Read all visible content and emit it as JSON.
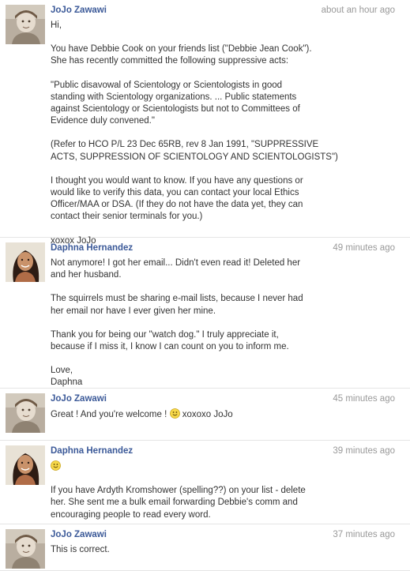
{
  "messages": [
    {
      "author": "JoJo Zawawi",
      "time": "about an hour ago",
      "paragraphs": [
        "Hi,",
        "You have Debbie Cook on your friends list (\"Debbie Jean Cook\").\nShe has recently committed the following suppressive acts:",
        "\"Public disavowal of Scientology or Scientologists in good\nstanding with Scientology organizations. ... Public statements\nagainst Scientology or Scientologists but not to Committees of\nEvidence duly convened.\"",
        "(Refer to HCO P/L 23 Dec 65RB, rev 8 Jan 1991, \"SUPPRESSIVE\nACTS, SUPPRESSION OF SCIENTOLOGY AND SCIENTOLOGISTS\")",
        "I thought you would want to know. If you have any questions or\nwould like to verify this data, you can contact your local Ethics\nOfficer/MAA or DSA. (If they do not have the data yet, they can\ncontact their senior terminals for you.)",
        "xoxox JoJo"
      ]
    },
    {
      "author": "Daphna Hernandez",
      "time": "49 minutes ago",
      "paragraphs": [
        "Not anymore! I got her email... Didn't even read it! Deleted her\nand her husband.",
        "The squirrels must be sharing e-mail lists, because I never had\nher email nor have I ever given her mine.",
        "Thank you for being our \"watch dog.\" I truly appreciate it,\nbecause if I miss it, I know I can count on you to inform me.",
        "Love,\nDaphna"
      ]
    },
    {
      "author": "JoJo Zawawi",
      "time": "45 minutes ago",
      "text_before_smiley": "Great ! And you're welcome ! ",
      "text_after_smiley": " xoxoxo JoJo"
    },
    {
      "author": "Daphna Hernandez",
      "time": "39 minutes ago",
      "paragraphs": [
        "If you have Ardyth Kromshower (spelling??) on your list - delete\nher. She sent me a bulk email forwarding Debbie's comm and\nencouraging people to read every word."
      ]
    },
    {
      "author": "JoJo Zawawi",
      "time": "37 minutes ago",
      "paragraphs": [
        "This is correct."
      ]
    }
  ],
  "colors": {
    "author_link": "#3b5998",
    "timestamp": "#999999",
    "divider": "#e5e5e5",
    "smiley": "#f7d84a"
  },
  "icons": {
    "jojo_avatar": "sepia-child-photo",
    "daphna_avatar": "woman-portrait-photo",
    "smiley": "smiley-emoticon"
  }
}
